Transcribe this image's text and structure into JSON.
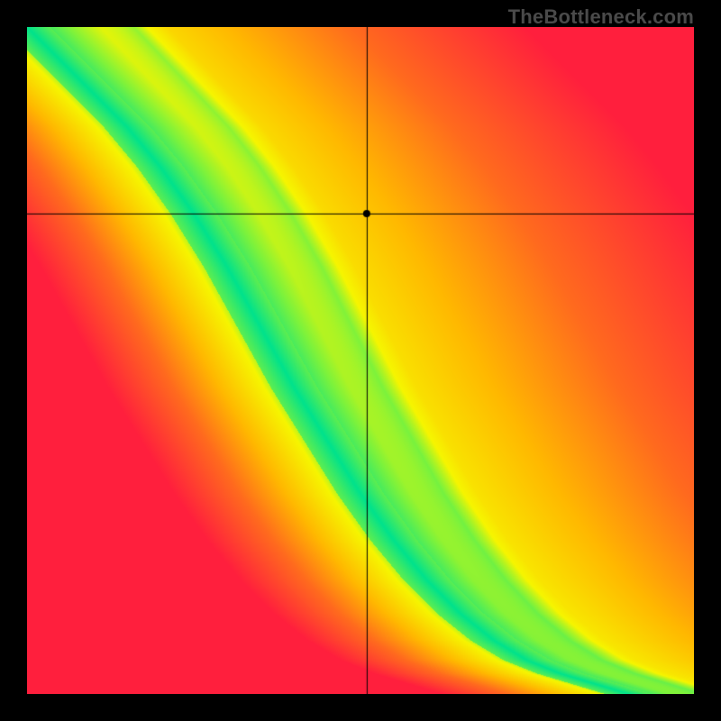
{
  "attribution": {
    "text": "TheBottleneck.com"
  },
  "chart_data": {
    "type": "heatmap",
    "title": "",
    "xlabel": "",
    "ylabel": "",
    "xlim": [
      0,
      1
    ],
    "ylim": [
      0,
      1
    ],
    "grid": false,
    "legend": false,
    "crosshair": {
      "x": 0.51,
      "y": 0.72
    },
    "marker": {
      "x": 0.51,
      "y": 0.72,
      "radius": 4,
      "color": "#000000"
    },
    "optimal_ridge": {
      "description": "green optimal band centerline, y as function of x; band half-width in x",
      "points": [
        {
          "x": 0.0,
          "y": 1.0
        },
        {
          "x": 0.05,
          "y": 0.95
        },
        {
          "x": 0.1,
          "y": 0.9
        },
        {
          "x": 0.15,
          "y": 0.85
        },
        {
          "x": 0.2,
          "y": 0.79
        },
        {
          "x": 0.25,
          "y": 0.72
        },
        {
          "x": 0.3,
          "y": 0.64
        },
        {
          "x": 0.35,
          "y": 0.55
        },
        {
          "x": 0.4,
          "y": 0.46
        },
        {
          "x": 0.45,
          "y": 0.38
        },
        {
          "x": 0.5,
          "y": 0.3
        },
        {
          "x": 0.55,
          "y": 0.23
        },
        {
          "x": 0.6,
          "y": 0.17
        },
        {
          "x": 0.65,
          "y": 0.12
        },
        {
          "x": 0.7,
          "y": 0.08
        },
        {
          "x": 0.75,
          "y": 0.05
        },
        {
          "x": 0.8,
          "y": 0.03
        },
        {
          "x": 0.9,
          "y": 0.0
        }
      ],
      "half_width_x": 0.035
    },
    "color_stops": [
      {
        "t": 0.0,
        "color": "#00e28c"
      },
      {
        "t": 0.08,
        "color": "#7cf23c"
      },
      {
        "t": 0.16,
        "color": "#f6f500"
      },
      {
        "t": 0.4,
        "color": "#ffb800"
      },
      {
        "t": 0.65,
        "color": "#ff6a1e"
      },
      {
        "t": 1.0,
        "color": "#ff1f3d"
      }
    ]
  }
}
